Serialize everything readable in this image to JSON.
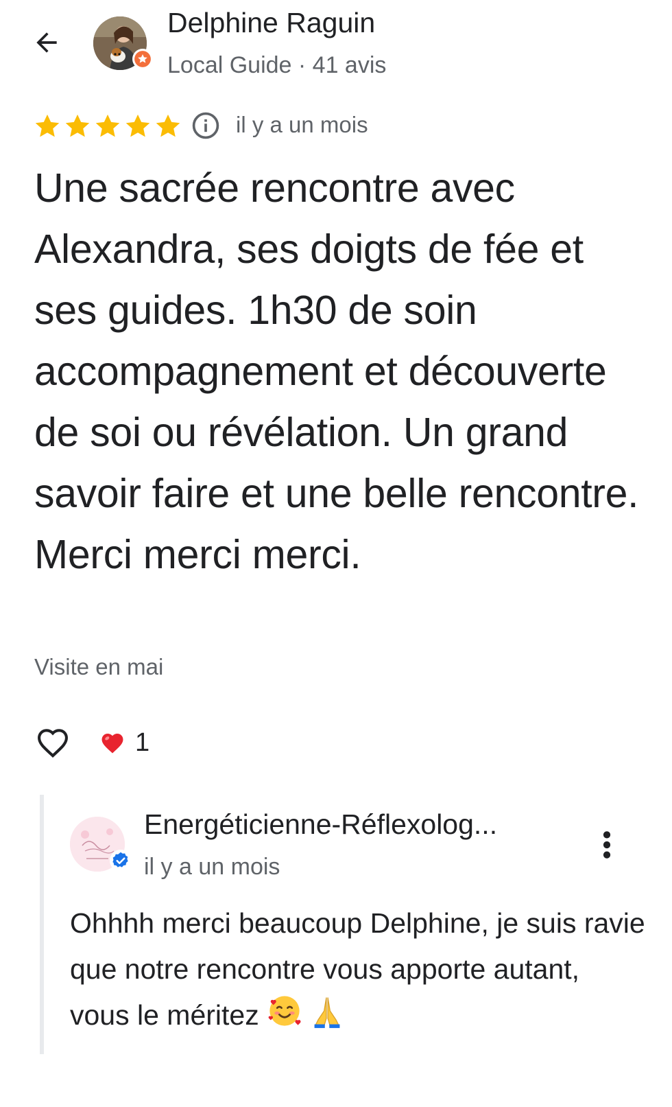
{
  "header": {
    "back_icon": "arrow-left-icon",
    "author_name": "Delphine Raguin",
    "author_meta": "Local Guide · 41 avis",
    "badge_icon": "local-guide-star-icon",
    "badge_color": "#f36f3b"
  },
  "review": {
    "rating": 5,
    "rating_max": 5,
    "star_color": "#fbbc04",
    "info_icon": "info-icon",
    "date": "il y a un mois",
    "text": "Une sacrée rencontre avec Alexandra, ses doigts de fée et ses guides. 1h30 de soin accompagnement et découverte de soi ou révélation. Un grand savoir faire et une belle rencontre. Merci merci merci.",
    "visit": "Visite en mai"
  },
  "reactions": {
    "like_icon": "heart-outline-icon",
    "reaction_icon": "red-heart-icon",
    "reaction_count": "1"
  },
  "reply": {
    "owner_name": "Energéticienne-Réflexolog...",
    "verified_icon": "verified-check-icon",
    "verified_color": "#1a73e8",
    "date": "il y a un mois",
    "more_icon": "more-vert-icon",
    "text": "Ohhhh merci beaucoup Delphine, je suis ravie que notre rencontre vous apporte autant, vous le méritez",
    "emojis": [
      "smiling-face-with-hearts-icon",
      "folded-hands-icon"
    ]
  }
}
